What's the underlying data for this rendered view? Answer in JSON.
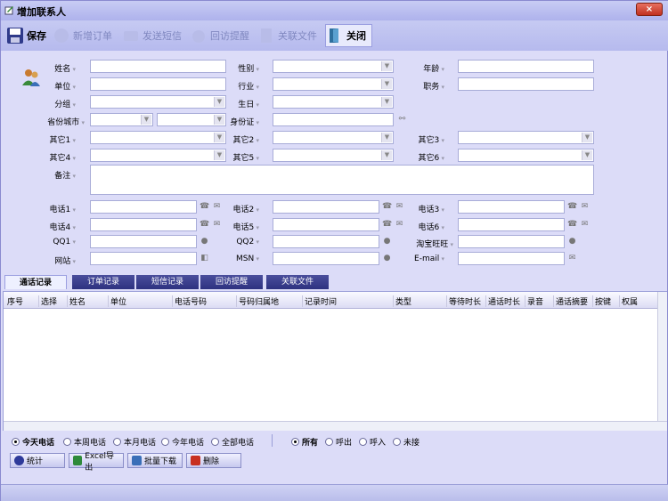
{
  "window": {
    "title": "增加联系人",
    "close_glyph": "×"
  },
  "toolbar": {
    "items": [
      {
        "label": "保存",
        "icon": "save-icon",
        "enabled": true
      },
      {
        "label": "新增订单",
        "icon": "order-icon",
        "enabled": false
      },
      {
        "label": "发送短信",
        "icon": "sms-icon",
        "enabled": false
      },
      {
        "label": "回访提醒",
        "icon": "reminder-icon",
        "enabled": false
      },
      {
        "label": "关联文件",
        "icon": "file-icon",
        "enabled": false
      },
      {
        "label": "关闭",
        "icon": "exit-door-icon",
        "enabled": true
      }
    ]
  },
  "form": {
    "name": "姓名",
    "gender": "性别",
    "age": "年龄",
    "company": "单位",
    "industry": "行业",
    "position": "职务",
    "group": "分组",
    "birthday": "生日",
    "province_city": "省份城市",
    "id_card": "身份证",
    "other1": "其它1",
    "other2": "其它2",
    "other3": "其它3",
    "other4": "其它4",
    "other5": "其它5",
    "other6": "其它6",
    "remark": "备注",
    "phone1": "电话1",
    "phone2": "电话2",
    "phone3": "电话3",
    "phone4": "电话4",
    "phone5": "电话5",
    "phone6": "电话6",
    "qq1": "QQ1",
    "qq2": "QQ2",
    "wangwang": "淘宝旺旺",
    "website": "网站",
    "msn": "MSN",
    "email": "E-mail"
  },
  "tabs": [
    "通话记录",
    "订单记录",
    "短信记录",
    "回访提醒",
    "关联文件"
  ],
  "grid": {
    "columns": [
      "序号",
      "选择",
      "姓名",
      "单位",
      "电话号码",
      "号码归属地",
      "记录时间",
      "类型",
      "等待时长",
      "通话时长",
      "录音",
      "通话摘要",
      "按键",
      "权属"
    ]
  },
  "filters_period": {
    "options": [
      "今天电话",
      "本周电话",
      "本月电话",
      "今年电话",
      "全部电话"
    ],
    "selected": "今天电话"
  },
  "filters_direction": {
    "options": [
      "所有",
      "呼出",
      "呼入",
      "未接"
    ],
    "selected": "所有"
  },
  "buttons": [
    "统计",
    "Excel导出",
    "批量下载",
    "删除"
  ],
  "colors": {
    "accent": "#2e3280",
    "window_bg": "#dcdcf8",
    "border": "#a8acd8"
  }
}
